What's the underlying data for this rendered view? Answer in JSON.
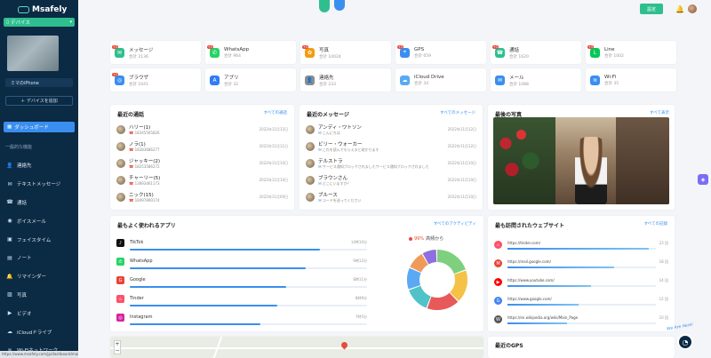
{
  "brand": {
    "name": "Msafely"
  },
  "device": {
    "selector_label": "デバイス",
    "name": "ミマのiPhone",
    "add_label": "＋ デバイスを追加"
  },
  "sidebar": {
    "dashboard_label": "ダッシュボード",
    "section_label": "一般的な機能",
    "items": [
      {
        "label": "連絡先",
        "icon": "contacts-icon",
        "glyph": "👤"
      },
      {
        "label": "テキストメッセージ",
        "icon": "message-icon",
        "glyph": "✉"
      },
      {
        "label": "通話",
        "icon": "phone-icon",
        "glyph": "☎"
      },
      {
        "label": "ボイスメール",
        "icon": "voicemail-icon",
        "glyph": "◉"
      },
      {
        "label": "フェイスタイム",
        "icon": "video-call-icon",
        "glyph": "▣"
      },
      {
        "label": "ノート",
        "icon": "note-icon",
        "glyph": "▤"
      },
      {
        "label": "リマインダー",
        "icon": "reminder-icon",
        "glyph": "🔔"
      },
      {
        "label": "写真",
        "icon": "photo-icon",
        "glyph": "▨"
      },
      {
        "label": "ビデオ",
        "icon": "video-icon",
        "glyph": "▶"
      },
      {
        "label": "iCloudドライブ",
        "icon": "cloud-icon",
        "glyph": "☁"
      },
      {
        "label": "Wi-Fiネットワーク",
        "icon": "wifi-icon",
        "glyph": "≋"
      }
    ]
  },
  "status_url": "https://www.msafely.com/jp/dashboard/main",
  "header": {
    "upgrade_label": "設定"
  },
  "stats": [
    {
      "title": "メッセージ",
      "count": "合計 2136",
      "badge": "+1",
      "color": "#2fbf8f",
      "glyph": "✉",
      "icon": "message-icon"
    },
    {
      "title": "WhatsApp",
      "count": "合計 964",
      "badge": "+1",
      "color": "#25d366",
      "glyph": "✆",
      "icon": "whatsapp-icon"
    },
    {
      "title": "写真",
      "count": "合計 10024",
      "badge": "+1",
      "color": "#f39c12",
      "glyph": "✿",
      "icon": "photos-icon"
    },
    {
      "title": "GPS",
      "count": "合計 659",
      "badge": "+1",
      "color": "#3a8ef0",
      "glyph": "⌖",
      "icon": "gps-icon"
    },
    {
      "title": "通話",
      "count": "合計 1620",
      "badge": "+1",
      "color": "#2fbf8f",
      "glyph": "☎",
      "icon": "phone-icon"
    },
    {
      "title": "Line",
      "count": "合計 1002",
      "badge": "+1",
      "color": "#06c755",
      "glyph": "L",
      "icon": "line-icon"
    },
    {
      "title": "ブラウザ",
      "count": "合計 1041",
      "badge": "+1",
      "color": "#3a8ef0",
      "glyph": "◎",
      "icon": "browser-icon"
    },
    {
      "title": "アプリ",
      "count": "合計 32",
      "badge": "",
      "color": "#2f7cf6",
      "glyph": "A",
      "icon": "appstore-icon"
    },
    {
      "title": "連絡先",
      "count": "合計 233",
      "badge": "",
      "color": "#8c8c8c",
      "glyph": "👤",
      "icon": "contacts-icon"
    },
    {
      "title": "iCloud Drive",
      "count": "合計 34",
      "badge": "",
      "color": "#5aa9f5",
      "glyph": "☁",
      "icon": "cloud-icon"
    },
    {
      "title": "メール",
      "count": "合計 1088",
      "badge": "",
      "color": "#3a8ef0",
      "glyph": "✉",
      "icon": "mail-icon"
    },
    {
      "title": "Wi-Fi",
      "count": "合計 35",
      "badge": "",
      "color": "#3a8ef0",
      "glyph": "≋",
      "icon": "wifi-icon"
    }
  ],
  "calls": {
    "title": "最近の通話",
    "link": "すべての通話",
    "rows": [
      {
        "name": "ハリー(1)",
        "sub": "18345565826",
        "date": "2022年11月12日"
      },
      {
        "name": "ノラ(1)",
        "sub": "18283686277",
        "date": "2022年11月11日"
      },
      {
        "name": "ジャッキー(2)",
        "sub": "18253586272",
        "date": "2022年11月10日"
      },
      {
        "name": "チャーリー(5)",
        "sub": "13893461173",
        "date": "2022年11月10日"
      },
      {
        "name": "ニック(15)",
        "sub": "18497890174",
        "date": "2022年11月09日"
      }
    ]
  },
  "messages": {
    "title": "最近のメッセージ",
    "link": "すべてのメッセージ",
    "rows": [
      {
        "name": "アンディ・ワトソン",
        "sub": "こんにちは",
        "date": "2022年11月12日"
      },
      {
        "name": "ビリー・ウォーカー",
        "sub": "これを読んでもらえると助かります",
        "date": "2022年11月12日"
      },
      {
        "name": "テルストラ",
        "sub": "サービス通知ブロックされましたサービス通知ブロックされました",
        "date": "2022年11月10日"
      },
      {
        "name": "ブラウンさん",
        "sub": "どこにいますか？",
        "date": "2022年11月10日"
      },
      {
        "name": "ブルース",
        "sub": "コードを送ってください",
        "date": "2022年11月10日"
      }
    ]
  },
  "photo": {
    "title": "最後の写真",
    "link": "すべて表示"
  },
  "apps": {
    "title": "最もよく使われるアプリ",
    "link": "すべてのアクティビティ",
    "rows": [
      {
        "name": "TikTok",
        "time": "14時10分",
        "value": 0.8,
        "color": "#111111",
        "glyph": "♪",
        "icon": "tiktok-icon"
      },
      {
        "name": "WhatsApp",
        "time": "9時12分",
        "value": 0.74,
        "color": "#25d366",
        "glyph": "✆",
        "icon": "whatsapp-icon"
      },
      {
        "name": "Google",
        "time": "8時11分",
        "value": 0.66,
        "color": "#ea4335",
        "glyph": "G",
        "icon": "google-icon"
      },
      {
        "name": "Tinder",
        "time": "8時9分",
        "value": 0.62,
        "color": "#fd5068",
        "glyph": "♨",
        "icon": "tinder-icon"
      },
      {
        "name": "Instagram",
        "time": "7時5分",
        "value": 0.55,
        "color": "#d6249f",
        "glyph": "◎",
        "icon": "instagram-icon"
      }
    ],
    "donut_pct": "99%",
    "donut_label": "高頻から",
    "donut": [
      {
        "value": 20,
        "color": "#7ed07e"
      },
      {
        "value": 18,
        "color": "#f5c146"
      },
      {
        "value": 18,
        "color": "#e8595a"
      },
      {
        "value": 14,
        "color": "#4fc3c8"
      },
      {
        "value": 12,
        "color": "#5aa9f5"
      },
      {
        "value": 10,
        "color": "#f09a5a"
      },
      {
        "value": 8,
        "color": "#8d6fe0"
      }
    ]
  },
  "sites": {
    "title": "最も訪問されたウェブサイト",
    "link": "すべての記録",
    "rows": [
      {
        "url": "https://tinder.com/",
        "count": "23 回",
        "value": 0.95,
        "color": "#fd5068",
        "glyph": "♨",
        "icon": "tinder-icon"
      },
      {
        "url": "https://mail.google.com/",
        "count": "18 回",
        "value": 0.72,
        "color": "#ea4335",
        "glyph": "M",
        "icon": "gmail-icon"
      },
      {
        "url": "https://www.youtube.com/",
        "count": "14 回",
        "value": 0.56,
        "color": "#ff0000",
        "glyph": "▶",
        "icon": "youtube-icon"
      },
      {
        "url": "https://www.google.com/",
        "count": "12 回",
        "value": 0.48,
        "color": "#4285f4",
        "glyph": "G",
        "icon": "google-icon"
      },
      {
        "url": "https://en.wikipedia.org/wiki/Main_Page",
        "count": "10 回",
        "value": 0.4,
        "color": "#555555",
        "glyph": "W",
        "icon": "wikipedia-icon"
      }
    ]
  },
  "gps": {
    "title": "最近のGPS"
  },
  "support": {
    "text": "We Are Here!"
  }
}
